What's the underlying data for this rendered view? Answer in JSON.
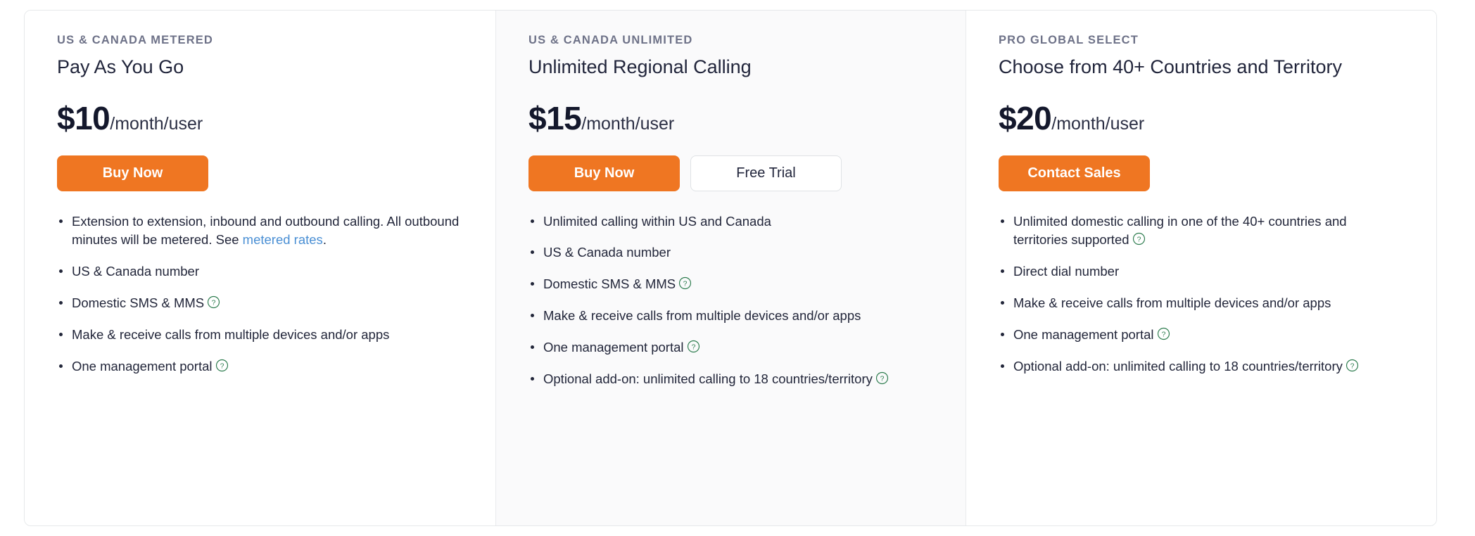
{
  "plans": [
    {
      "eyebrow": "US & CANADA METERED",
      "name": "Pay As You Go",
      "price_amount": "$10",
      "price_period": "/month/user",
      "actions": [
        {
          "label": "Buy Now",
          "style": "primary"
        }
      ],
      "features": [
        {
          "text_before": "Extension to extension, inbound and outbound calling. All outbound minutes will be metered. See ",
          "link": "metered rates",
          "text_after": ".",
          "help": false
        },
        {
          "text_before": "US & Canada number",
          "link": "",
          "text_after": "",
          "help": false
        },
        {
          "text_before": "Domestic SMS & MMS",
          "link": "",
          "text_after": "",
          "help": true
        },
        {
          "text_before": "Make & receive calls from multiple devices and/or apps",
          "link": "",
          "text_after": "",
          "help": false
        },
        {
          "text_before": "One management portal",
          "link": "",
          "text_after": "",
          "help": true
        }
      ]
    },
    {
      "eyebrow": "US & CANADA UNLIMITED",
      "name": "Unlimited Regional Calling",
      "price_amount": "$15",
      "price_period": "/month/user",
      "actions": [
        {
          "label": "Buy Now",
          "style": "primary"
        },
        {
          "label": "Free Trial",
          "style": "secondary"
        }
      ],
      "features": [
        {
          "text_before": "Unlimited calling within US and Canada",
          "link": "",
          "text_after": "",
          "help": false
        },
        {
          "text_before": "US & Canada number",
          "link": "",
          "text_after": "",
          "help": false
        },
        {
          "text_before": "Domestic SMS & MMS",
          "link": "",
          "text_after": "",
          "help": true
        },
        {
          "text_before": "Make & receive calls from multiple devices and/or apps",
          "link": "",
          "text_after": "",
          "help": false
        },
        {
          "text_before": "One management portal",
          "link": "",
          "text_after": "",
          "help": true
        },
        {
          "text_before": "Optional add-on: unlimited calling to 18 countries/territory",
          "link": "",
          "text_after": "",
          "help": true
        }
      ]
    },
    {
      "eyebrow": "PRO GLOBAL SELECT",
      "name": "Choose from 40+ Countries and Territory",
      "price_amount": "$20",
      "price_period": "/month/user",
      "actions": [
        {
          "label": "Contact Sales",
          "style": "primary"
        }
      ],
      "features": [
        {
          "text_before": "Unlimited domestic calling in one of the 40+ countries and territories supported",
          "link": "",
          "text_after": "",
          "help": true
        },
        {
          "text_before": "Direct dial number",
          "link": "",
          "text_after": "",
          "help": false
        },
        {
          "text_before": "Make & receive calls from multiple devices and/or apps",
          "link": "",
          "text_after": "",
          "help": false
        },
        {
          "text_before": "One management portal",
          "link": "",
          "text_after": "",
          "help": true
        },
        {
          "text_before": "Optional add-on: unlimited calling to 18 countries/territory",
          "link": "",
          "text_after": "",
          "help": true
        }
      ]
    }
  ],
  "icons": {
    "help": "help-circle-icon"
  },
  "colors": {
    "accent_orange": "#ef7622",
    "link_blue": "#4a8fd4",
    "help_icon_green": "#2e7d4f",
    "eyebrow_gray": "#6e7288",
    "text_dark": "#21253b",
    "card_border": "#e6e8ea",
    "col2_background": "#fafafb"
  }
}
